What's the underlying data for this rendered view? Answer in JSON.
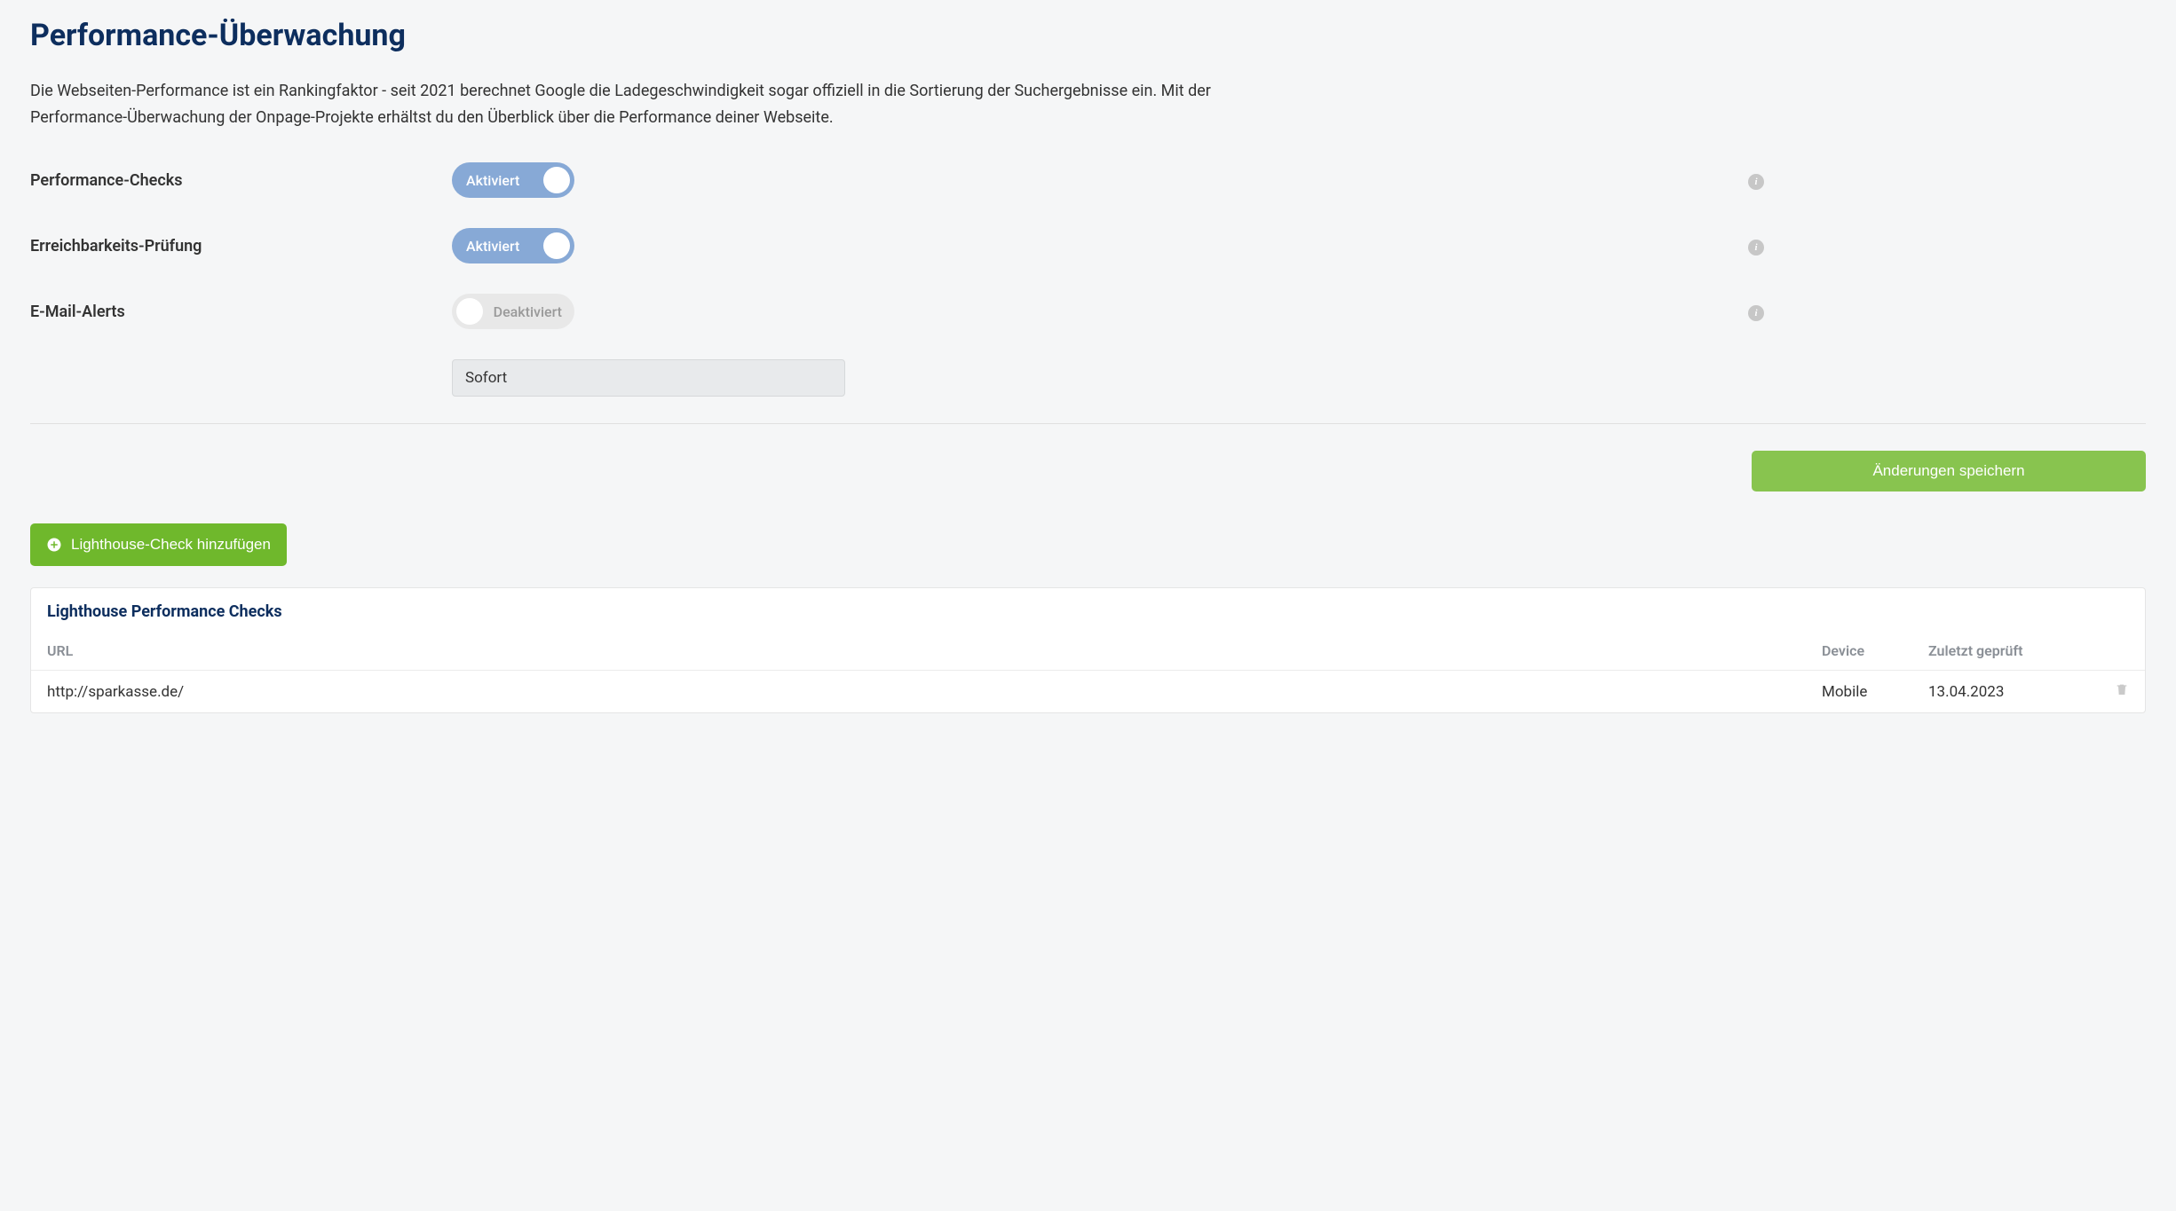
{
  "title": "Performance-Überwachung",
  "description": "Die Webseiten-Performance ist ein Rankingfaktor - seit 2021 berechnet Google die Ladegeschwindigkeit sogar offiziell in die Sortierung der Suchergebnisse ein. Mit der Performance-Überwachung der Onpage-Projekte erhältst du den Überblick über die Performance deiner Webseite.",
  "settings": {
    "performance_checks": {
      "label": "Performance-Checks",
      "state_label": "Aktiviert",
      "on": true
    },
    "reachability": {
      "label": "Erreichbarkeits-Prüfung",
      "state_label": "Aktiviert",
      "on": true
    },
    "email_alerts": {
      "label": "E-Mail-Alerts",
      "state_label": "Deaktiviert",
      "on": false
    },
    "frequency_selected": "Sofort"
  },
  "buttons": {
    "save": "Änderungen speichern",
    "add_lighthouse": "Lighthouse-Check hinzufügen"
  },
  "panel": {
    "title": "Lighthouse Performance Checks",
    "columns": {
      "url": "URL",
      "device": "Device",
      "last_checked": "Zuletzt geprüft"
    },
    "rows": [
      {
        "url": "http://sparkasse.de/",
        "device": "Mobile",
        "last_checked": "13.04.2023"
      }
    ]
  }
}
